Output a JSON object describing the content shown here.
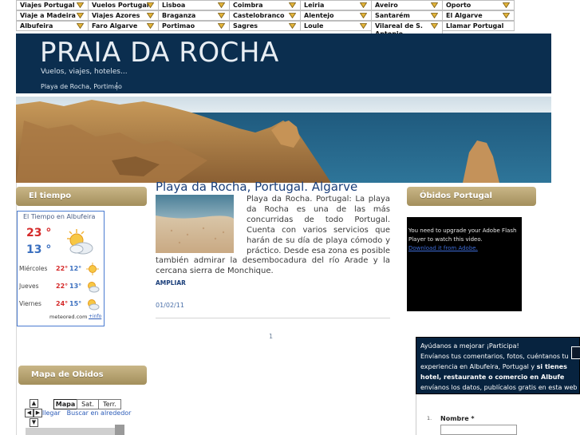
{
  "menu": [
    {
      "label": "Viajes Portugal"
    },
    {
      "label": "Vuelos Portugal"
    },
    {
      "label": "Lisboa"
    },
    {
      "label": "Coimbra"
    },
    {
      "label": "Leiria"
    },
    {
      "label": "Aveiro"
    },
    {
      "label": "Oporto"
    },
    {
      "label": "Viaje a Madeira"
    },
    {
      "label": "Viajes Azores"
    },
    {
      "label": "Braganza"
    },
    {
      "label": "Castelobranco"
    },
    {
      "label": "Alentejo"
    },
    {
      "label": "Santarém"
    },
    {
      "label": "El Algarve"
    },
    {
      "label": "Albufeira"
    },
    {
      "label": "Faro Algarve"
    },
    {
      "label": "Portimao"
    },
    {
      "label": "Sagres"
    },
    {
      "label": "Loule"
    },
    {
      "label": "Vilareal de S. Antonio"
    },
    {
      "label": "Llamar Portugal"
    }
  ],
  "header": {
    "title": "PRAIA DA ROCHA",
    "tagline": "Vuelos, viajes, hoteles...",
    "nav_link": "Playa de Rocha, Portimao"
  },
  "weather": {
    "widget_title": "El tiempo",
    "header": "El Tiempo en Albufeira",
    "today_max": "23 °",
    "today_min": "13 °",
    "days": [
      {
        "day": "Miércoles",
        "max": "22°",
        "min": "12°",
        "icon": "sun-icon"
      },
      {
        "day": "Jueves",
        "max": "22°",
        "min": "13°",
        "icon": "sun-cloud-icon"
      },
      {
        "day": "Viernes",
        "max": "24°",
        "min": "15°",
        "icon": "sun-cloud-icon"
      }
    ],
    "brand": "meteored.com",
    "info": "+info"
  },
  "map": {
    "widget_title": "Mapa de Obidos",
    "buttons": [
      "Mapa",
      "Sat.",
      "Terr."
    ],
    "links": [
      "llegar",
      "Buscar en alrededor"
    ]
  },
  "article": {
    "title": "Playa da Rocha, Portugal. Algarve",
    "body": "Playa da Rocha. Portugal: La playa da Rocha es una de las más concurridas de todo Portugal. Cuenta con varios servicios que harán de su día de playa cómodo y práctico. Desde esa zona es posible también admirar la desembocadura del río Arade y la cercana sierra de Monchique.",
    "read_more": "AMPLIAR",
    "date": "01/02/11"
  },
  "pagination": {
    "current": "1"
  },
  "sidebar_right": {
    "widget_title": "Óbidos Portugal",
    "flash_message": "You need to upgrade your Adobe Flash Player to watch this video.",
    "flash_link": "Download it from Adobe."
  },
  "help": {
    "line1": "Ayúdanos a mejorar ¡Participa!",
    "line2": "Envíanos tus comentarios, fotos, cuéntanos tu",
    "line3": "experiencia en Albufeira, Portugal y",
    "line3_bold": "si tienes",
    "line4_bold": "hotel, restaurante o comercio en Albufe",
    "line5": "envíanos los datos, publícalos gratis en esta web"
  },
  "form": {
    "number": "1.",
    "name_label": "Nombre *"
  }
}
